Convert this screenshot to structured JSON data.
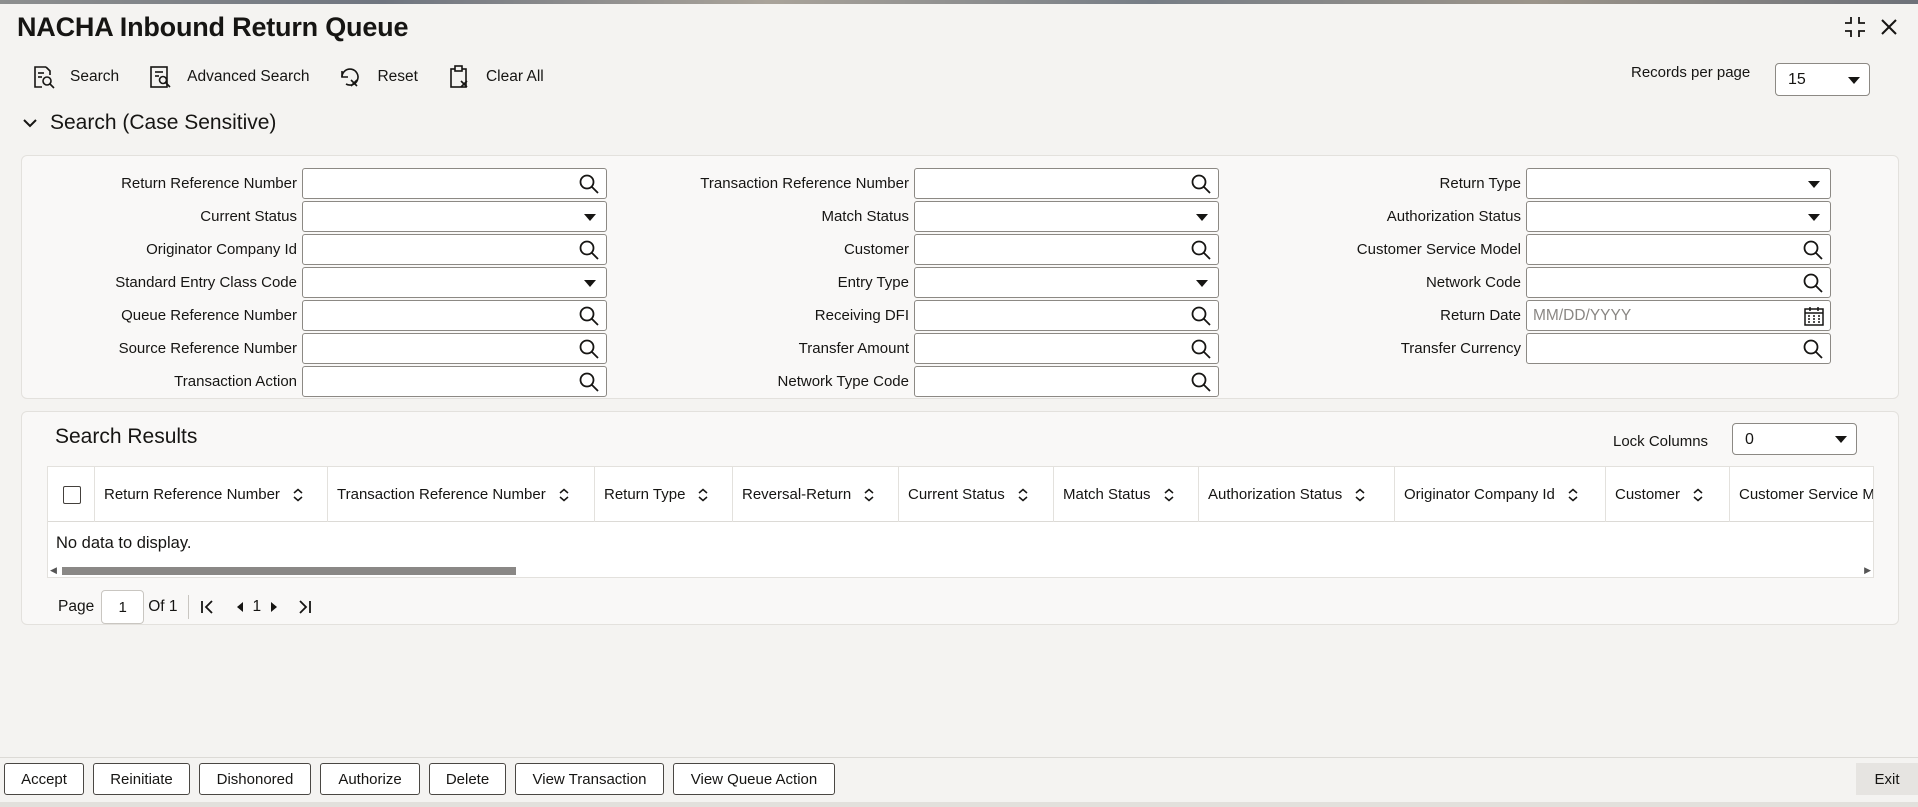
{
  "app": {
    "title": "NACHA Inbound Return Queue"
  },
  "toolbar": {
    "search_label": "Search",
    "advanced_search_label": "Advanced Search",
    "reset_label": "Reset",
    "clear_all_label": "Clear All"
  },
  "records_per_page": {
    "label": "Records per page",
    "value": "15"
  },
  "search_section": {
    "title": "Search (Case Sensitive)",
    "fields": {
      "return_reference_number": "Return Reference Number",
      "current_status": "Current Status",
      "originator_company_id": "Originator Company Id",
      "standard_entry_class_code": "Standard Entry Class Code",
      "queue_reference_number": "Queue Reference Number",
      "source_reference_number": "Source Reference Number",
      "transaction_action": "Transaction Action",
      "transaction_reference_number": "Transaction Reference Number",
      "match_status": "Match Status",
      "customer": "Customer",
      "entry_type": "Entry Type",
      "receiving_dfi": "Receiving DFI",
      "transfer_amount": "Transfer Amount",
      "network_type_code": "Network Type Code",
      "return_type": "Return Type",
      "authorization_status": "Authorization Status",
      "customer_service_model": "Customer Service Model",
      "network_code": "Network Code",
      "return_date": "Return Date",
      "transfer_currency": "Transfer Currency"
    },
    "return_date_placeholder": "MM/DD/YYYY"
  },
  "results": {
    "title": "Search Results",
    "lock_columns_label": "Lock Columns",
    "lock_columns_value": "0",
    "columns": [
      "Return Reference Number",
      "Transaction Reference Number",
      "Return Type",
      "Reversal-Return",
      "Current Status",
      "Match Status",
      "Authorization Status",
      "Originator Company Id",
      "Customer",
      "Customer Service M"
    ],
    "empty_message": "No data to display."
  },
  "pagination": {
    "page_label": "Page",
    "current_page": "1",
    "of_label": "Of 1",
    "page_link": "1"
  },
  "footer": {
    "accept": "Accept",
    "reinitiate": "Reinitiate",
    "dishonored": "Dishonored",
    "authorize": "Authorize",
    "delete": "Delete",
    "view_transaction": "View Transaction",
    "view_queue_action": "View Queue Action",
    "exit": "Exit"
  }
}
